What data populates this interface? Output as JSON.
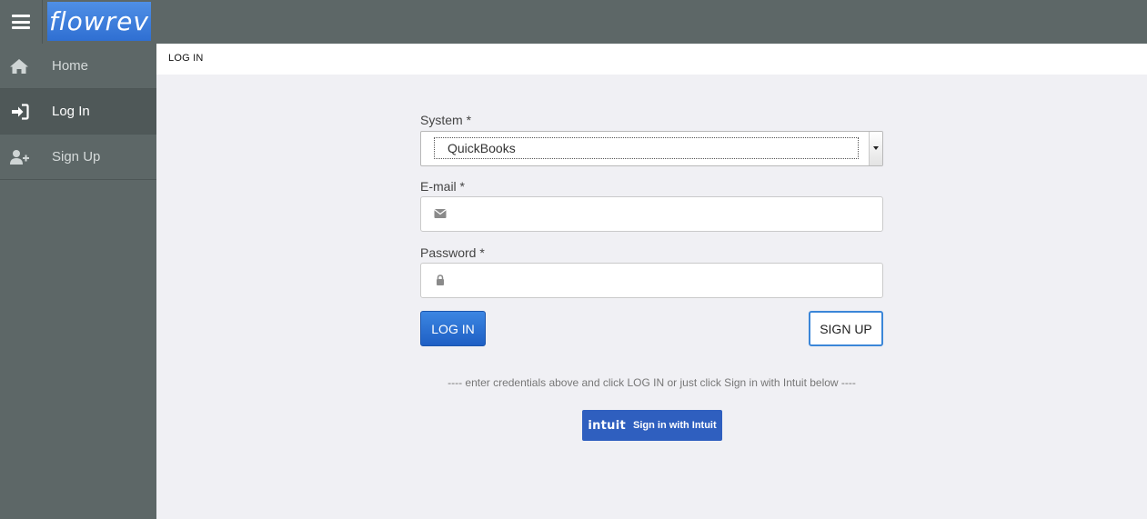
{
  "header": {
    "brand": "flowrev"
  },
  "sidebar": {
    "items": [
      {
        "label": "Home",
        "icon": "home-icon",
        "active": false
      },
      {
        "label": "Log In",
        "icon": "sign-in-icon",
        "active": true
      },
      {
        "label": "Sign Up",
        "icon": "user-plus-icon",
        "active": false
      }
    ]
  },
  "breadcrumb": "LOG IN",
  "form": {
    "system_label": "System *",
    "system_value": "QuickBooks",
    "email_label": "E-mail *",
    "email_value": "",
    "password_label": "Password *",
    "password_value": "",
    "login_button": "LOG IN",
    "signup_button": "SIGN UP",
    "hint": "----   enter credentials above and click LOG IN or just click Sign in with Intuit below   ----",
    "intuit_logo": "intuit",
    "intuit_button": "Sign in with Intuit"
  },
  "colors": {
    "topbar": "#5d6767",
    "brand": "#2f6fd2",
    "primary_button": "#1e5fc4",
    "intuit_button": "#2f5fbf",
    "background": "#f0f0f4"
  }
}
